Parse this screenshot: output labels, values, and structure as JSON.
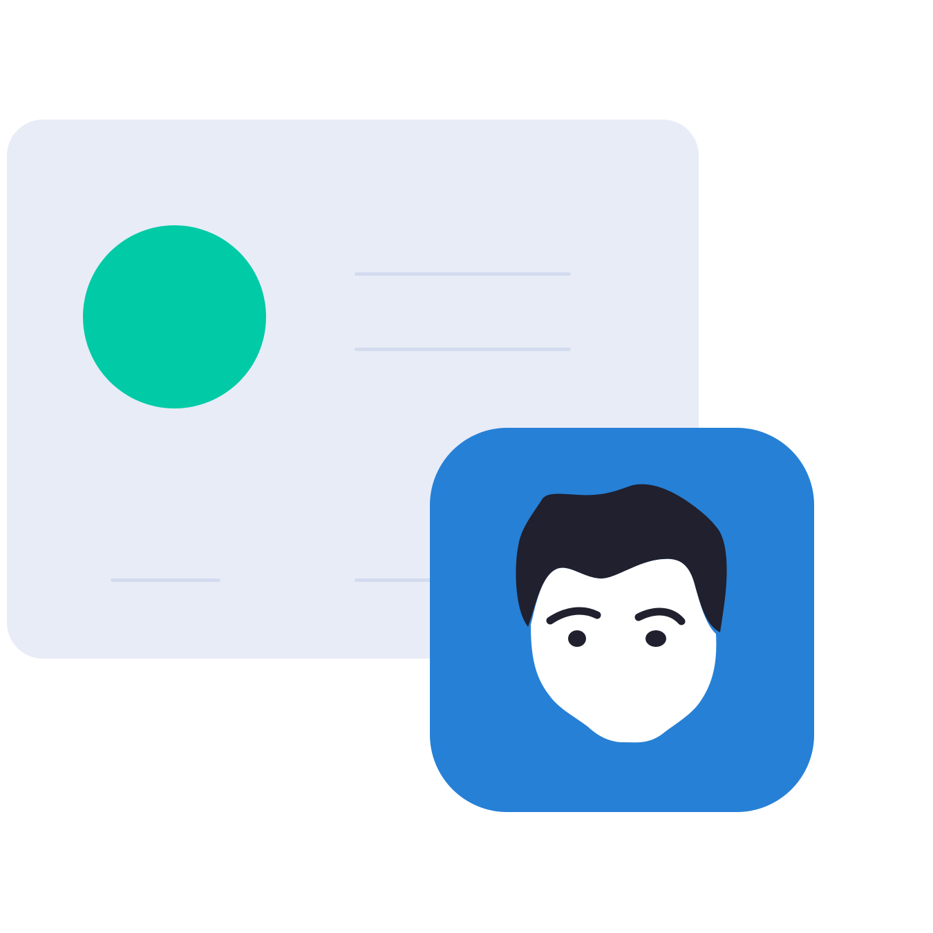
{
  "colors": {
    "background": "#ffffff",
    "card": "#e8ecf7",
    "card_lines": "#d3dbef",
    "photo_placeholder": "#00cba6",
    "avatar_tile": "#2680d6",
    "hair_and_features": "#20202e",
    "face": "#ffffff"
  },
  "icons": {
    "card": "id-card-icon",
    "photo": "photo-placeholder-icon",
    "avatar": "user-avatar-icon"
  }
}
